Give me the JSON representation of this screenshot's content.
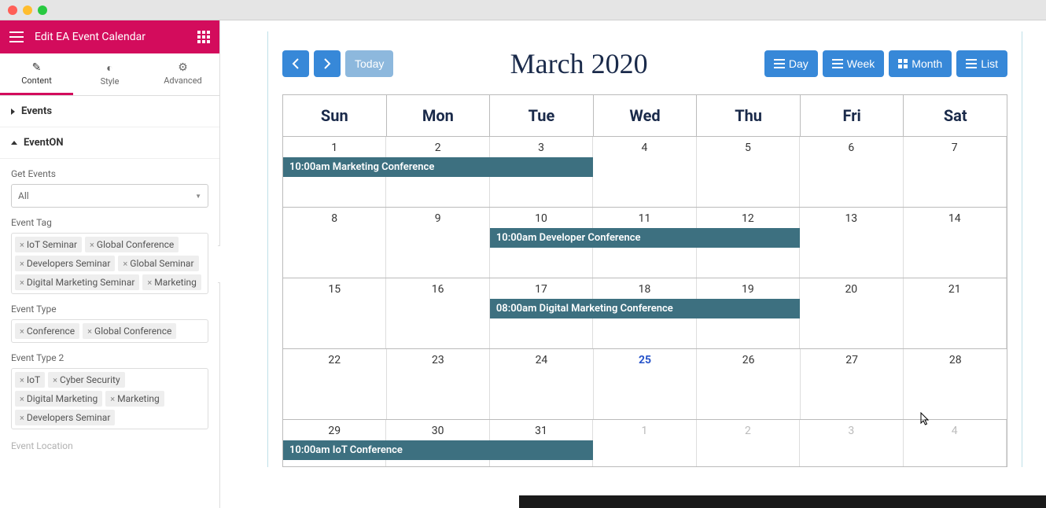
{
  "header": {
    "title": "Edit EA Event Calendar"
  },
  "tabs": {
    "content": "Content",
    "style": "Style",
    "advanced": "Advanced"
  },
  "sections": {
    "events": "Events",
    "eventon": "EventON",
    "event_location": "Event Location"
  },
  "controls": {
    "get_events_label": "Get Events",
    "get_events_value": "All",
    "event_tag_label": "Event Tag",
    "event_tag_values": [
      "IoT Seminar",
      "Global Conference",
      "Developers Seminar",
      "Global Seminar",
      "Digital Marketing Seminar",
      "Marketing"
    ],
    "event_type_label": "Event Type",
    "event_type_values": [
      "Conference",
      "Global Conference"
    ],
    "event_type2_label": "Event Type 2",
    "event_type2_values": [
      "IoT",
      "Cyber Security",
      "Digital Marketing",
      "Marketing",
      "Developers Seminar"
    ]
  },
  "calendar": {
    "title": "March 2020",
    "today_btn": "Today",
    "views": {
      "day": "Day",
      "week": "Week",
      "month": "Month",
      "list": "List"
    },
    "day_headers": [
      "Sun",
      "Mon",
      "Tue",
      "Wed",
      "Thu",
      "Fri",
      "Sat"
    ],
    "weeks": [
      {
        "dates": [
          "1",
          "2",
          "3",
          "4",
          "5",
          "6",
          "7"
        ],
        "today": null,
        "other": []
      },
      {
        "dates": [
          "8",
          "9",
          "10",
          "11",
          "12",
          "13",
          "14"
        ],
        "today": null,
        "other": []
      },
      {
        "dates": [
          "15",
          "16",
          "17",
          "18",
          "19",
          "20",
          "21"
        ],
        "today": null,
        "other": []
      },
      {
        "dates": [
          "22",
          "23",
          "24",
          "25",
          "26",
          "27",
          "28"
        ],
        "today": 3,
        "other": []
      },
      {
        "dates": [
          "29",
          "30",
          "31",
          "1",
          "2",
          "3",
          "4"
        ],
        "today": null,
        "other": [
          3,
          4,
          5,
          6
        ]
      }
    ],
    "events": [
      {
        "row": 0,
        "start": 0,
        "span": 3,
        "text": "10:00am Marketing Conference"
      },
      {
        "row": 1,
        "start": 2,
        "span": 3,
        "text": "10:00am Developer Conference"
      },
      {
        "row": 2,
        "start": 2,
        "span": 3,
        "text": "08:00am Digital Marketing Conference"
      },
      {
        "row": 4,
        "start": 0,
        "span": 3,
        "text": "10:00am IoT Conference"
      }
    ]
  }
}
